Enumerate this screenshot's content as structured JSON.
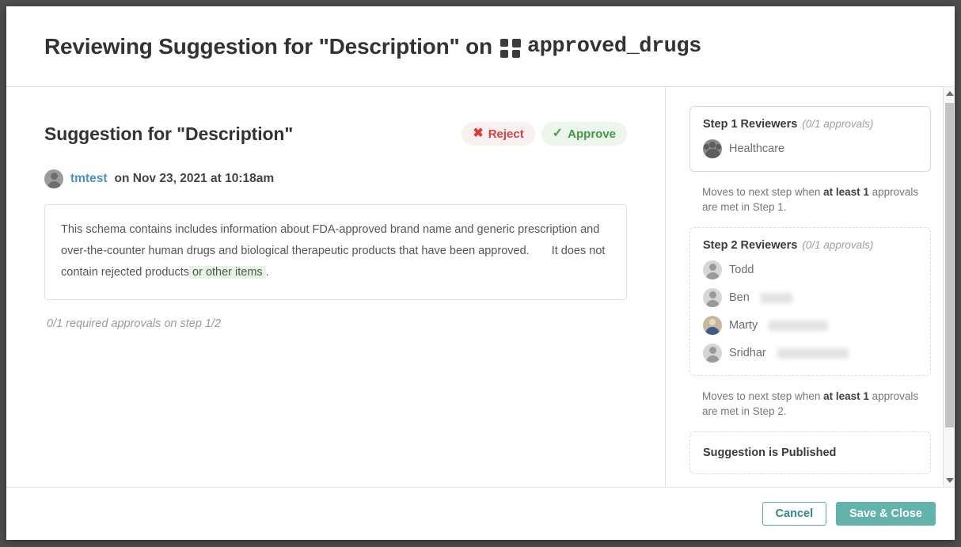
{
  "header": {
    "title_prefix": "Reviewing Suggestion for \"Description\" on ",
    "table_name": "approved_drugs",
    "grid_icon": "grid-icon"
  },
  "suggestion": {
    "heading": "Suggestion for \"Description\"",
    "reject_label": "Reject",
    "reject_icon": "x-icon",
    "approve_label": "Approve",
    "approve_icon": "check-icon",
    "author": "tmtest",
    "author_meta": "on Nov 23, 2021 at 10:18am",
    "avatar_icon": "user-avatar-icon",
    "body_part1": "This schema contains includes information about FDA-approved brand name and generic prescription and over-the-counter human drugs and biological therapeutic products that have been approved.",
    "body_deleted": " ",
    "body_inserted_space": " ",
    "body_part2": "It does not contain rejected products",
    "body_inserted": " or other items ",
    "body_part3": ".",
    "approvals_note": "0/1 required approvals on step 1/2"
  },
  "workflow": {
    "step1": {
      "title": "Step 1 Reviewers",
      "count": "(0/1 approvals)",
      "reviewers": [
        {
          "name": "Healthcare",
          "avatar": "group-avatar-icon",
          "redacted_width": 0
        }
      ],
      "note_prefix": "Moves to next step when ",
      "note_bold": "at least 1",
      "note_suffix": " approvals are met in Step 1."
    },
    "step2": {
      "title": "Step 2 Reviewers",
      "count": "(0/1 approvals)",
      "reviewers": [
        {
          "name": "Todd",
          "avatar": "user-avatar-icon",
          "redacted_width": 0
        },
        {
          "name": "Ben",
          "avatar": "user-avatar-icon",
          "redacted_width": 40
        },
        {
          "name": "Marty",
          "avatar": "photo-avatar-icon",
          "redacted_width": 75
        },
        {
          "name": "Sridhar",
          "avatar": "user-avatar-icon",
          "redacted_width": 90
        }
      ],
      "note_prefix": "Moves to next step when ",
      "note_bold": "at least 1",
      "note_suffix": " approvals are met in Step 2."
    },
    "published": {
      "title": "Suggestion is Published"
    }
  },
  "scrollbar": {
    "up_icon": "scroll-up-arrow-icon",
    "down_icon": "scroll-down-arrow-icon"
  },
  "footer": {
    "cancel_label": "Cancel",
    "save_label": "Save & Close"
  },
  "colors": {
    "accent_teal": "#63b3ab",
    "link_blue": "#4a90c4",
    "reject_red": "#d64242",
    "approve_green": "#3f9a44",
    "insert_green_bg": "#e4f5e2",
    "delete_red_bg": "#fbe6e6"
  }
}
